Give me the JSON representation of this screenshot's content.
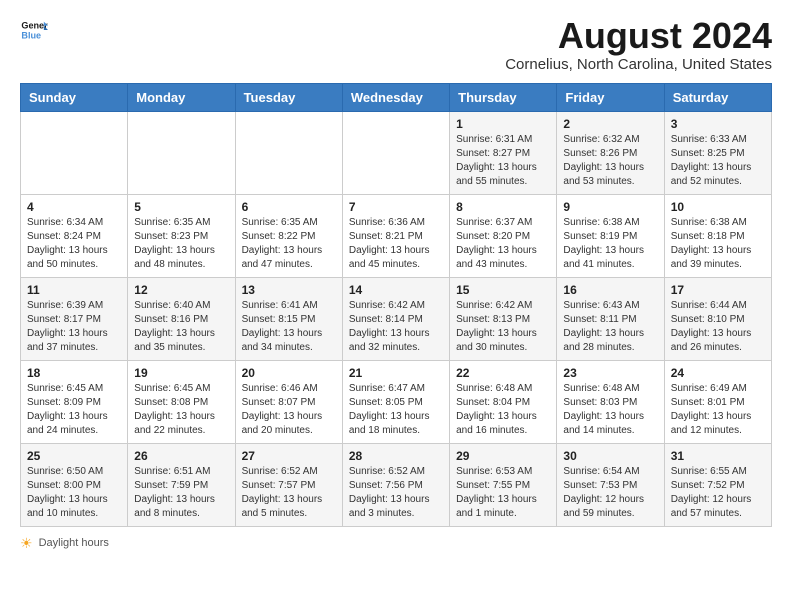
{
  "logo": {
    "line1": "General",
    "line2": "Blue"
  },
  "title": "August 2024",
  "subtitle": "Cornelius, North Carolina, United States",
  "weekdays": [
    "Sunday",
    "Monday",
    "Tuesday",
    "Wednesday",
    "Thursday",
    "Friday",
    "Saturday"
  ],
  "footer": {
    "label": "Daylight hours"
  },
  "weeks": [
    [
      {
        "day": "",
        "info": ""
      },
      {
        "day": "",
        "info": ""
      },
      {
        "day": "",
        "info": ""
      },
      {
        "day": "",
        "info": ""
      },
      {
        "day": "1",
        "info": "Sunrise: 6:31 AM\nSunset: 8:27 PM\nDaylight: 13 hours\nand 55 minutes."
      },
      {
        "day": "2",
        "info": "Sunrise: 6:32 AM\nSunset: 8:26 PM\nDaylight: 13 hours\nand 53 minutes."
      },
      {
        "day": "3",
        "info": "Sunrise: 6:33 AM\nSunset: 8:25 PM\nDaylight: 13 hours\nand 52 minutes."
      }
    ],
    [
      {
        "day": "4",
        "info": "Sunrise: 6:34 AM\nSunset: 8:24 PM\nDaylight: 13 hours\nand 50 minutes."
      },
      {
        "day": "5",
        "info": "Sunrise: 6:35 AM\nSunset: 8:23 PM\nDaylight: 13 hours\nand 48 minutes."
      },
      {
        "day": "6",
        "info": "Sunrise: 6:35 AM\nSunset: 8:22 PM\nDaylight: 13 hours\nand 47 minutes."
      },
      {
        "day": "7",
        "info": "Sunrise: 6:36 AM\nSunset: 8:21 PM\nDaylight: 13 hours\nand 45 minutes."
      },
      {
        "day": "8",
        "info": "Sunrise: 6:37 AM\nSunset: 8:20 PM\nDaylight: 13 hours\nand 43 minutes."
      },
      {
        "day": "9",
        "info": "Sunrise: 6:38 AM\nSunset: 8:19 PM\nDaylight: 13 hours\nand 41 minutes."
      },
      {
        "day": "10",
        "info": "Sunrise: 6:38 AM\nSunset: 8:18 PM\nDaylight: 13 hours\nand 39 minutes."
      }
    ],
    [
      {
        "day": "11",
        "info": "Sunrise: 6:39 AM\nSunset: 8:17 PM\nDaylight: 13 hours\nand 37 minutes."
      },
      {
        "day": "12",
        "info": "Sunrise: 6:40 AM\nSunset: 8:16 PM\nDaylight: 13 hours\nand 35 minutes."
      },
      {
        "day": "13",
        "info": "Sunrise: 6:41 AM\nSunset: 8:15 PM\nDaylight: 13 hours\nand 34 minutes."
      },
      {
        "day": "14",
        "info": "Sunrise: 6:42 AM\nSunset: 8:14 PM\nDaylight: 13 hours\nand 32 minutes."
      },
      {
        "day": "15",
        "info": "Sunrise: 6:42 AM\nSunset: 8:13 PM\nDaylight: 13 hours\nand 30 minutes."
      },
      {
        "day": "16",
        "info": "Sunrise: 6:43 AM\nSunset: 8:11 PM\nDaylight: 13 hours\nand 28 minutes."
      },
      {
        "day": "17",
        "info": "Sunrise: 6:44 AM\nSunset: 8:10 PM\nDaylight: 13 hours\nand 26 minutes."
      }
    ],
    [
      {
        "day": "18",
        "info": "Sunrise: 6:45 AM\nSunset: 8:09 PM\nDaylight: 13 hours\nand 24 minutes."
      },
      {
        "day": "19",
        "info": "Sunrise: 6:45 AM\nSunset: 8:08 PM\nDaylight: 13 hours\nand 22 minutes."
      },
      {
        "day": "20",
        "info": "Sunrise: 6:46 AM\nSunset: 8:07 PM\nDaylight: 13 hours\nand 20 minutes."
      },
      {
        "day": "21",
        "info": "Sunrise: 6:47 AM\nSunset: 8:05 PM\nDaylight: 13 hours\nand 18 minutes."
      },
      {
        "day": "22",
        "info": "Sunrise: 6:48 AM\nSunset: 8:04 PM\nDaylight: 13 hours\nand 16 minutes."
      },
      {
        "day": "23",
        "info": "Sunrise: 6:48 AM\nSunset: 8:03 PM\nDaylight: 13 hours\nand 14 minutes."
      },
      {
        "day": "24",
        "info": "Sunrise: 6:49 AM\nSunset: 8:01 PM\nDaylight: 13 hours\nand 12 minutes."
      }
    ],
    [
      {
        "day": "25",
        "info": "Sunrise: 6:50 AM\nSunset: 8:00 PM\nDaylight: 13 hours\nand 10 minutes."
      },
      {
        "day": "26",
        "info": "Sunrise: 6:51 AM\nSunset: 7:59 PM\nDaylight: 13 hours\nand 8 minutes."
      },
      {
        "day": "27",
        "info": "Sunrise: 6:52 AM\nSunset: 7:57 PM\nDaylight: 13 hours\nand 5 minutes."
      },
      {
        "day": "28",
        "info": "Sunrise: 6:52 AM\nSunset: 7:56 PM\nDaylight: 13 hours\nand 3 minutes."
      },
      {
        "day": "29",
        "info": "Sunrise: 6:53 AM\nSunset: 7:55 PM\nDaylight: 13 hours\nand 1 minute."
      },
      {
        "day": "30",
        "info": "Sunrise: 6:54 AM\nSunset: 7:53 PM\nDaylight: 12 hours\nand 59 minutes."
      },
      {
        "day": "31",
        "info": "Sunrise: 6:55 AM\nSunset: 7:52 PM\nDaylight: 12 hours\nand 57 minutes."
      }
    ]
  ]
}
